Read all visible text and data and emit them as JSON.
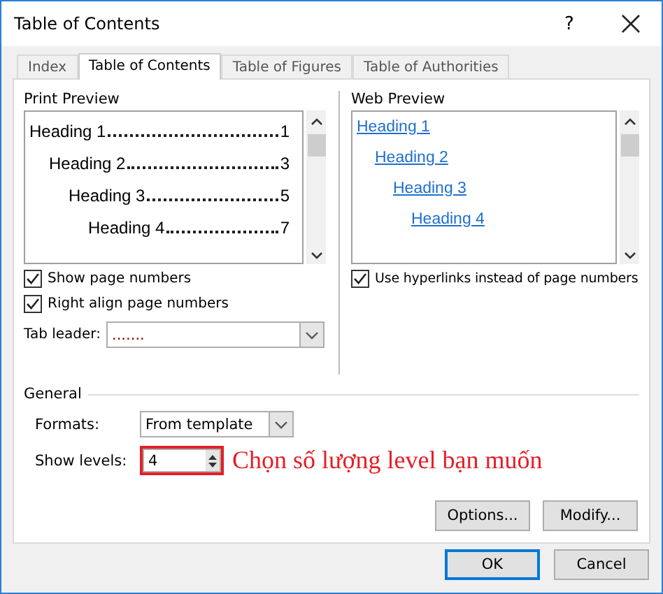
{
  "window": {
    "title": "Table of Contents",
    "help": "?"
  },
  "tabs": [
    {
      "label": "Index",
      "selected": false
    },
    {
      "label": "Table of Contents",
      "selected": true
    },
    {
      "label": "Table of Figures",
      "selected": false
    },
    {
      "label": "Table of Authorities",
      "selected": false
    }
  ],
  "print_preview": {
    "label": "Print Preview",
    "entries": [
      {
        "text": "Heading 1",
        "page": "1",
        "children": [
          {
            "text": "Heading 2",
            "page": "3",
            "children": [
              {
                "text": "Heading 3",
                "page": "5",
                "children": [
                  {
                    "text": "Heading 4",
                    "page": "7"
                  }
                ]
              }
            ]
          }
        ]
      }
    ]
  },
  "web_preview": {
    "label": "Web Preview",
    "entries": [
      {
        "text": "Heading 1",
        "children": [
          {
            "text": "Heading 2",
            "children": [
              {
                "text": "Heading 3",
                "children": [
                  {
                    "text": "Heading 4"
                  }
                ]
              }
            ]
          }
        ]
      }
    ]
  },
  "print_options": [
    {
      "label": "Show page numbers",
      "checked": true
    },
    {
      "label": "Right align page numbers",
      "checked": true
    }
  ],
  "web_options": [
    {
      "label": "Use hyperlinks instead of page numbers",
      "checked": true
    }
  ],
  "tab_leader": {
    "label": "Tab leader:",
    "value": "......."
  },
  "general": {
    "title": "General",
    "formats": {
      "label": "Formats:",
      "value": "From template"
    },
    "show_levels": {
      "label": "Show levels:",
      "value": "4"
    }
  },
  "annotation": {
    "text": "Chọn số lượng level bạn muốn"
  },
  "side_buttons": [
    "Options...",
    "Modify..."
  ],
  "footer_buttons": [
    {
      "label": "OK",
      "default": true
    },
    {
      "label": "Cancel",
      "default": false
    }
  ]
}
